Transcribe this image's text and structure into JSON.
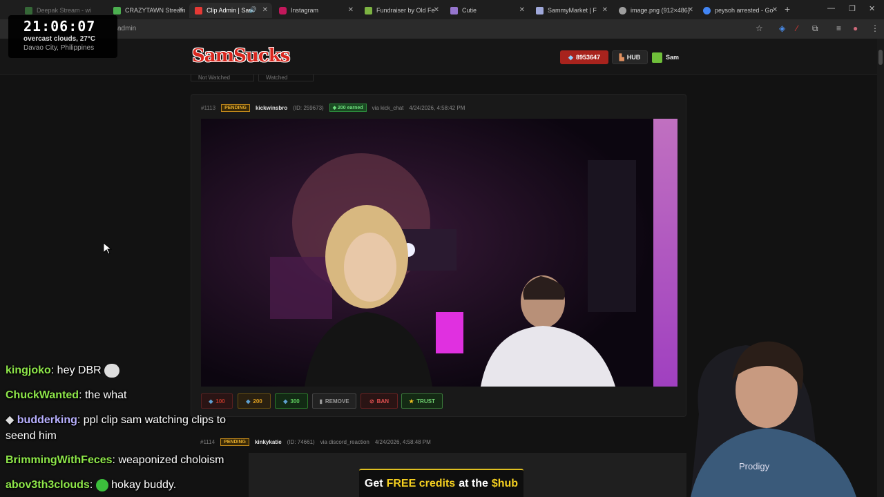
{
  "browser": {
    "tabs": [
      {
        "label": "Deepak Stream - wi",
        "color": "#4caf50"
      },
      {
        "label": "CRAZYTAWN Stream",
        "color": "#4caf50"
      },
      {
        "label": "Clip Admin | Sam",
        "color": "#e53935"
      },
      {
        "label": "Instagram",
        "color": "#c2185b"
      },
      {
        "label": "Fundraiser by Old Fe",
        "color": "#7cb342"
      },
      {
        "label": "Cutie",
        "color": "#9575cd"
      },
      {
        "label": "SammyMarket | F",
        "color": "#9fa8da"
      },
      {
        "label": "image.png (912×486)",
        "color": "#9e9e9e"
      },
      {
        "label": "peysoh arrested - Go",
        "color": "#4285f4"
      }
    ],
    "new_tab": "+",
    "url": "admin"
  },
  "site": {
    "logo": "SamSucks",
    "balance": "8953647",
    "hub": "HUB",
    "user": "Sam",
    "filters": [
      "Not Watched",
      "Watched"
    ]
  },
  "clips": [
    {
      "id": "#1113",
      "status": "PENDING",
      "user": "kickwinsbro",
      "user_id": "(ID: 259673)",
      "earned": "200 earned",
      "via": "via kick_chat",
      "date": "4/24/2026, 4:58:42 PM",
      "actions": [
        {
          "label": "100",
          "color": "#c0392b"
        },
        {
          "label": "200",
          "color": "#e0a020"
        },
        {
          "label": "300",
          "color": "#5fd05f"
        },
        {
          "label": "REMOVE",
          "color": "#999999"
        },
        {
          "label": "BAN",
          "color": "#e05050"
        },
        {
          "label": "TRUST",
          "color": "#6fd06f"
        }
      ]
    },
    {
      "id": "#1114",
      "status": "PENDING",
      "user": "kinkykatie",
      "user_id": "(ID: 74661)",
      "via": "via discord_reaction",
      "date": "4/24/2026, 4:58:48 PM"
    }
  ],
  "overlay": {
    "time": "21:06:07",
    "weather": "overcast clouds, 27°C",
    "location": "Davao City, Philippines"
  },
  "chat": [
    {
      "user": "kingjoko",
      "text": "hey DBR"
    },
    {
      "user": "ChuckWanted",
      "text": "the what"
    },
    {
      "user": "budderking",
      "text": "ppl clip sam watching clips to",
      "text2": "seend him"
    },
    {
      "user": "BrimmingWithFeces",
      "text": "weaponized choloism"
    },
    {
      "user": "abov3th3clouds",
      "text": "hokay buddy."
    }
  ],
  "banner": {
    "prefix": "Get",
    "highlight": "FREE credits",
    "middle": "at the",
    "highlight2": "$hub"
  }
}
